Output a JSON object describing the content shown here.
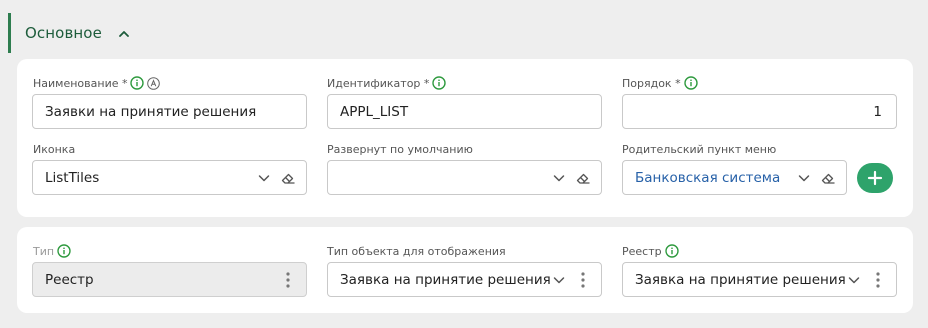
{
  "section": {
    "title": "Основное"
  },
  "fields": {
    "name": {
      "label": "Наименование *",
      "value": "Заявки на принятие решения"
    },
    "identifier": {
      "label": "Идентификатор *",
      "value": "APPL_LIST"
    },
    "order": {
      "label": "Порядок *",
      "value": "1"
    },
    "icon": {
      "label": "Иконка",
      "value": "ListTiles"
    },
    "expanded": {
      "label": "Развернут по умолчанию",
      "value": ""
    },
    "parent_menu": {
      "label": "Родительский пункт меню",
      "value": "Банковская система"
    },
    "type": {
      "label": "Тип",
      "value": "Реестр"
    },
    "object_type": {
      "label": "Тип объекта для отображения",
      "value": "Заявка на принятие решения"
    },
    "registry": {
      "label": "Реестр",
      "value": "Заявка на принятие решения"
    }
  },
  "colors": {
    "accent": "#2e7d4f",
    "add_button": "#2ea36b",
    "link": "#2761a8"
  },
  "icons": [
    "chevron-up-icon",
    "info-icon",
    "auto-icon",
    "chevron-down-icon",
    "eraser-icon",
    "more-vertical-icon",
    "plus-icon"
  ]
}
